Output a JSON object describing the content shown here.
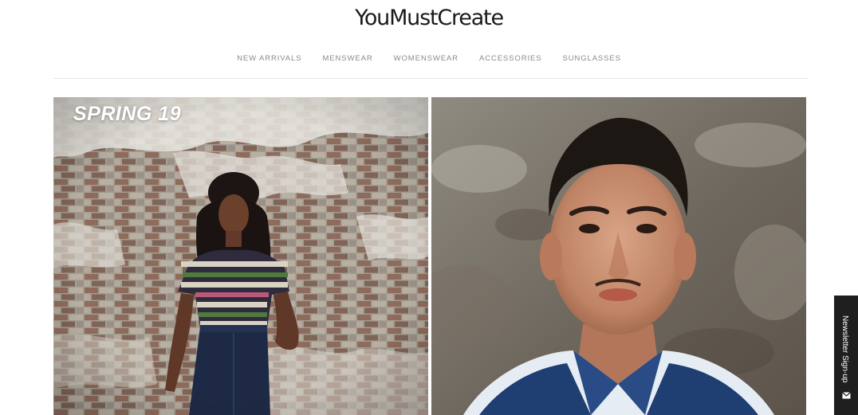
{
  "header": {
    "logo_text": "YouMustCreate"
  },
  "nav": {
    "items": [
      {
        "label": "NEW ARRIVALS"
      },
      {
        "label": "MENSWEAR"
      },
      {
        "label": "WOMENSWEAR"
      },
      {
        "label": "ACCESSORIES"
      },
      {
        "label": "SUNGLASSES"
      }
    ]
  },
  "hero": {
    "left": {
      "title": "SPRING 19"
    }
  },
  "newsletter": {
    "label": "Newsletter Sign-up",
    "icon": "envelope-icon"
  },
  "colors": {
    "text_dark": "#1a1a1a",
    "nav_text": "#8a8a8a",
    "tab_bg": "#1f1f1f"
  }
}
